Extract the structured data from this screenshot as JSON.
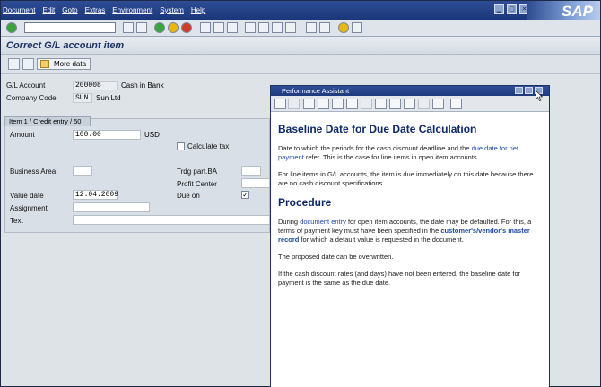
{
  "menu": {
    "items": [
      "Document",
      "Edit",
      "Goto",
      "Extras",
      "Environment",
      "System",
      "Help"
    ]
  },
  "window_buttons": [
    "▁",
    "▢",
    "✕"
  ],
  "brand": "SAP",
  "title": "Correct G/L account item",
  "toolbar": {
    "more_data": "More data"
  },
  "header": {
    "gl_account_label": "G/L Account",
    "gl_account_value": "200008",
    "gl_account_text": "Cash in Bank",
    "company_code_label": "Company Code",
    "company_code_value": "SUN",
    "company_code_text": "Sun Ltd"
  },
  "item": {
    "tab_label": "Item 1 / Credit entry / 50",
    "amount_label": "Amount",
    "amount_value": "100.00",
    "currency": "USD",
    "calculate_tax_label": "Calculate tax",
    "business_area_label": "Business Area",
    "trdg_part_label": "Trdg part.BA",
    "profit_center_label": "Profit Center",
    "value_date_label": "Value date",
    "value_date_value": "12.04.2009",
    "due_on_label": "Due on",
    "due_on_checked": true,
    "assignment_label": "Assignment",
    "text_label": "Text"
  },
  "assistant": {
    "window_title": "Performance Assistant",
    "heading": "Baseline Date for Due Date Calculation",
    "p1_pre": "Date to which the periods for the cash discount deadline and the ",
    "p1_link": "due date for net payment",
    "p1_post": " refer. This is the case for line items in open item accounts.",
    "p2": "For line items in G/L accounts, the item is due immediately on this date because there are no cash discount specifications.",
    "procedure_heading": "Procedure",
    "p3_pre": "During ",
    "p3_link1": "document entry",
    "p3_mid": " for open item accounts, the date may be defaulted. For this, a terms of payment key must have been specified in the ",
    "p3_link2": "customer's/vendor's master record",
    "p3_post": " for which a default value is requested in the document.",
    "p4": "The proposed date can be overwritten.",
    "p5": "If the cash discount rates (and days) have not been entered, the baseline date for payment is the same as the due date."
  }
}
